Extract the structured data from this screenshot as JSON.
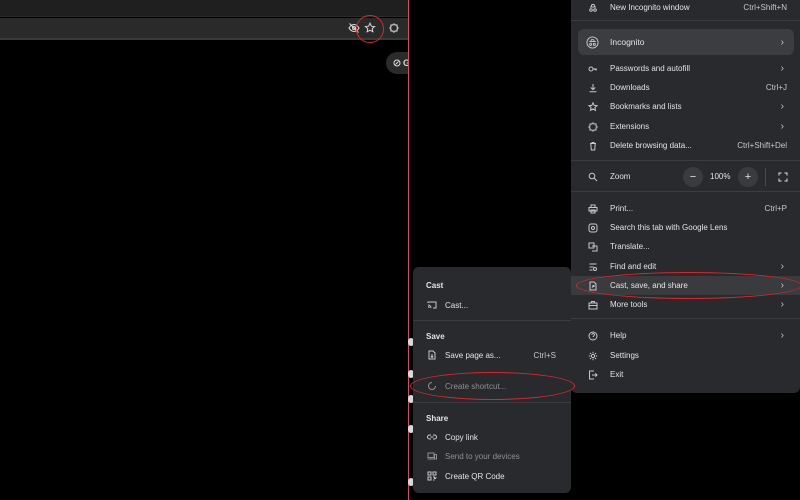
{
  "main_menu": {
    "items": [
      {
        "id": "new-incognito",
        "label": "New Incognito window",
        "shortcut": "Ctrl+Shift+N",
        "icon": "incognito-window-icon"
      },
      {
        "id": "incognito",
        "label": "Incognito",
        "icon": "incognito-icon"
      },
      {
        "id": "passwords",
        "label": "Passwords and autofill",
        "icon": "key-icon"
      },
      {
        "id": "downloads",
        "label": "Downloads",
        "shortcut": "Ctrl+J",
        "icon": "download-icon"
      },
      {
        "id": "bookmarks",
        "label": "Bookmarks and lists",
        "icon": "star-icon"
      },
      {
        "id": "extensions",
        "label": "Extensions",
        "icon": "puzzle-icon"
      },
      {
        "id": "delete-data",
        "label": "Delete browsing data...",
        "shortcut": "Ctrl+Shift+Del",
        "icon": "trash-icon"
      },
      {
        "id": "zoom",
        "label": "Zoom",
        "icon": "magnifier-icon"
      },
      {
        "id": "print",
        "label": "Print...",
        "shortcut": "Ctrl+P",
        "icon": "printer-icon"
      },
      {
        "id": "lens",
        "label": "Search this tab with Google Lens",
        "icon": "lens-icon"
      },
      {
        "id": "translate",
        "label": "Translate...",
        "icon": "translate-icon"
      },
      {
        "id": "find-edit",
        "label": "Find and edit",
        "icon": "find-icon"
      },
      {
        "id": "cast-save-share",
        "label": "Cast, save, and share",
        "icon": "file-share-icon"
      },
      {
        "id": "more-tools",
        "label": "More tools",
        "icon": "toolbox-icon"
      },
      {
        "id": "help",
        "label": "Help",
        "icon": "help-icon"
      },
      {
        "id": "settings",
        "label": "Settings",
        "icon": "gear-icon"
      },
      {
        "id": "exit",
        "label": "Exit",
        "icon": "exit-icon"
      }
    ],
    "zoom": {
      "minus": "−",
      "value": "100%",
      "plus": "+"
    }
  },
  "sub_menu": {
    "cast_heading": "Cast",
    "cast_item": "Cast...",
    "save_heading": "Save",
    "save_page": "Save page as...",
    "save_page_shortcut": "Ctrl+S",
    "create_shortcut": "Create shortcut...",
    "share_heading": "Share",
    "copy_link": "Copy link",
    "send_devices": "Send to your devices",
    "qr_code": "Create QR Code"
  },
  "left_pane": {
    "chip_label": "G"
  },
  "colors": {
    "menu_bg": "#292a2d",
    "annotation_red": "#e0242c",
    "highlight": "#3a3b3e"
  }
}
